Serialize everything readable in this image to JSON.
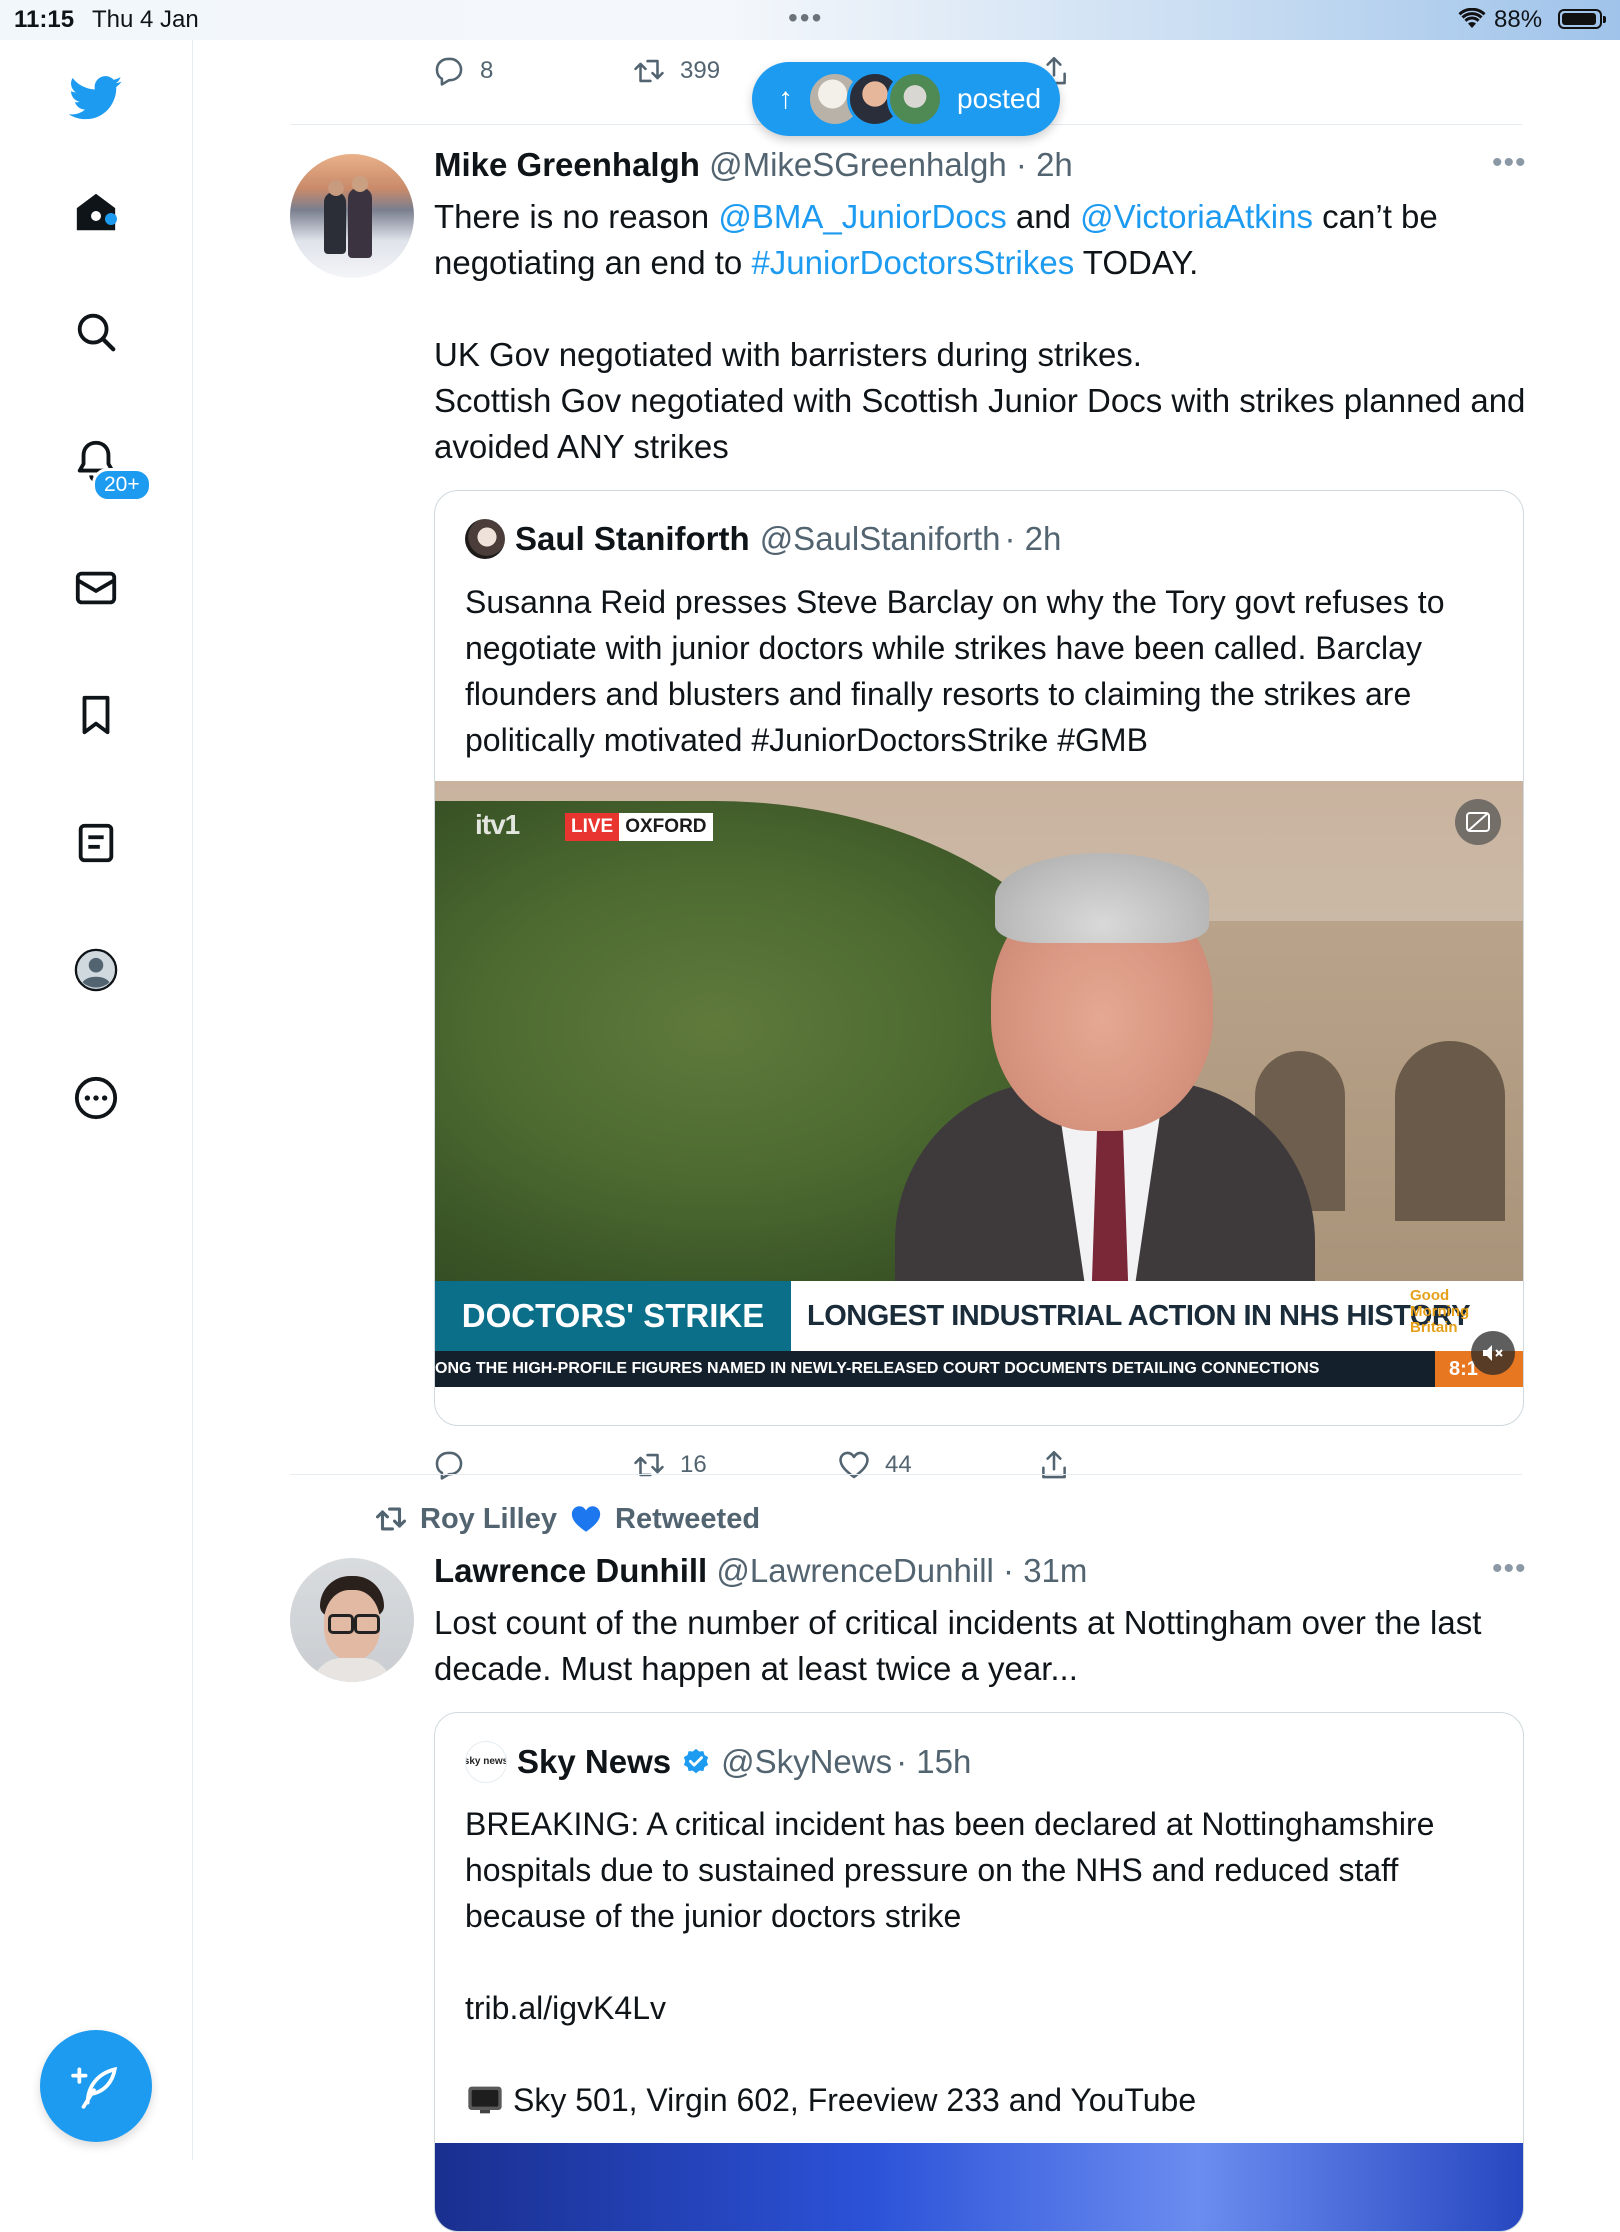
{
  "status_bar": {
    "time": "11:15",
    "date": "Thu 4 Jan",
    "battery": "88%"
  },
  "sidebar": {
    "notifications_badge": "20+",
    "icons": [
      "twitter-logo",
      "home",
      "search",
      "notifications",
      "messages",
      "bookmarks",
      "lists",
      "profile",
      "more"
    ]
  },
  "prev_tweet_actions": {
    "replies": "8",
    "retweets": "399"
  },
  "posted_pill": {
    "label": "posted"
  },
  "tweet1": {
    "name": "Mike Greenhalgh",
    "handle": "@MikeSGreenhalgh",
    "time": "· 2h",
    "text_p1_a": "There is no reason ",
    "text_p1_mention1": "@BMA_JuniorDocs",
    "text_p1_b": " and ",
    "text_p1_mention2": "@VictoriaAtkins",
    "text_p1_c": " can’t be negotiating an end to ",
    "text_p1_hashtag": "#JuniorDoctorsStrikes",
    "text_p1_d": " TODAY.",
    "text_p2_line1": "UK Gov negotiated with barristers during strikes.",
    "text_p2_line2": "Scottish Gov negotiated with Scottish Junior Docs with strikes planned and avoided ANY strikes",
    "quote": {
      "name": "Saul Staniforth",
      "handle": "@SaulStaniforth",
      "time": "· 2h",
      "text": "Susanna Reid presses Steve Barclay on why the Tory govt refuses to negotiate with junior doctors while strikes have been called. Barclay flounders and blusters and finally resorts to claiming the strikes are politically motivated #JuniorDoctorsStrike #GMB",
      "video": {
        "channel": "itv1",
        "live": "LIVE",
        "location": "OXFORD",
        "banner_left": "DOCTORS' STRIKE",
        "banner_right": "LONGEST INDUSTRIAL ACTION IN NHS HISTORY",
        "show": "Good Morning Britain",
        "ticker": "ONG THE HIGH-PROFILE FIGURES NAMED IN NEWLY-RELEASED COURT DOCUMENTS DETAILING CONNECTIONS",
        "clock": "8:1"
      }
    },
    "actions": {
      "replies": "",
      "retweets": "16",
      "likes": "44"
    }
  },
  "tweet2": {
    "retweeted_by": "Roy Lilley",
    "retweeted_label": "Retweeted",
    "name": "Lawrence Dunhill",
    "handle": "@LawrenceDunhill",
    "time": "· 31m",
    "text": "Lost count of the number of critical incidents at Nottingham over the last decade. Must happen at least twice a year...",
    "quote": {
      "name": "Sky News",
      "handle": "@SkyNews",
      "time": "· 15h",
      "avatar_text": "sky news",
      "text_p1": "BREAKING: A critical incident has been declared at Nottinghamshire hospitals due to sustained pressure on the NHS and reduced staff because of the junior doctors strike",
      "text_p2": "trib.al/igvK4Lv",
      "text_p3": "Sky 501, Virgin 602, Freeview 233 and YouTube"
    }
  }
}
